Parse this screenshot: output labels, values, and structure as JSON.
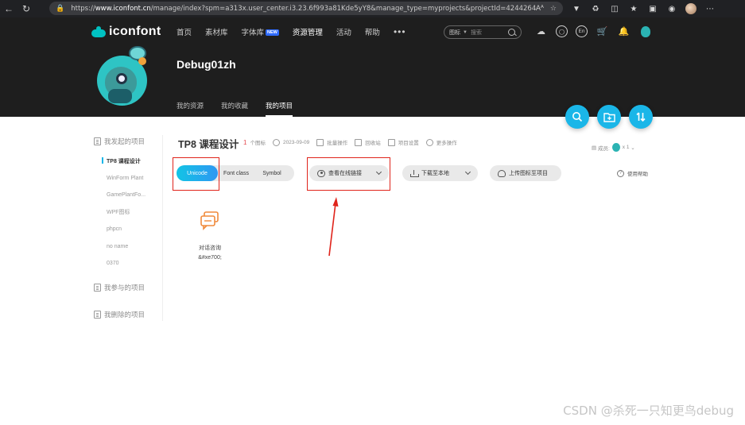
{
  "browser": {
    "url_prefix": "https://",
    "url_host": "www.iconfont.cn",
    "url_path": "/manage/index?spm=a313x.user_center.i3.23.6f993a81Kde5yY8&manage_type=myprojects&projectId=4244264",
    "reader_label": "Aᴬ"
  },
  "header": {
    "logo_text": "iconfont",
    "nav": [
      {
        "label": "首页"
      },
      {
        "label": "素材库"
      },
      {
        "label": "字体库",
        "badge": "NEW"
      },
      {
        "label": "资源管理"
      },
      {
        "label": "活动"
      },
      {
        "label": "帮助"
      }
    ],
    "more_label": "•••",
    "search_scope": "图标",
    "search_placeholder": "搜索",
    "lang_label": "En"
  },
  "user": {
    "name": "Debug01zh",
    "tabs": [
      "我的资源",
      "我的收藏",
      "我的项目"
    ]
  },
  "sidebar": {
    "my_projects_label": "我发起的项目",
    "projects": [
      "TP8 课程设计",
      "WinForm Plant",
      "GamePlantFo...",
      "WPF图标",
      "phpcn",
      "no name",
      "0370"
    ],
    "joined_label": "我参与的项目",
    "deleted_label": "我删除的项目"
  },
  "project": {
    "title": "TP8 课程设计",
    "icon_count": "1",
    "icon_count_unit": "个图标",
    "date": "2023-09-09",
    "batch_label": "批量操作",
    "recycle_label": "回收站",
    "settings_label": "项目设置",
    "more_label": "更多操作",
    "members_label": "成员:",
    "members_count": "x 1"
  },
  "toolbar": {
    "tabs": [
      "Unicode",
      "Font class",
      "Symbol"
    ],
    "view_online_label": "查看在线链接",
    "download_label": "下载至本地",
    "upload_label": "上传图标至项目",
    "help_label": "使用帮助"
  },
  "icons": [
    {
      "name": "对话咨询",
      "code": "&#xe700;"
    }
  ],
  "colors": {
    "accent": "#1ab6e8",
    "annotation_red": "#e0241b",
    "header_bg": "#1e1e1e",
    "icon_orange": "#f08a3c"
  },
  "watermark": "CSDN @杀死一只知更鸟debug"
}
